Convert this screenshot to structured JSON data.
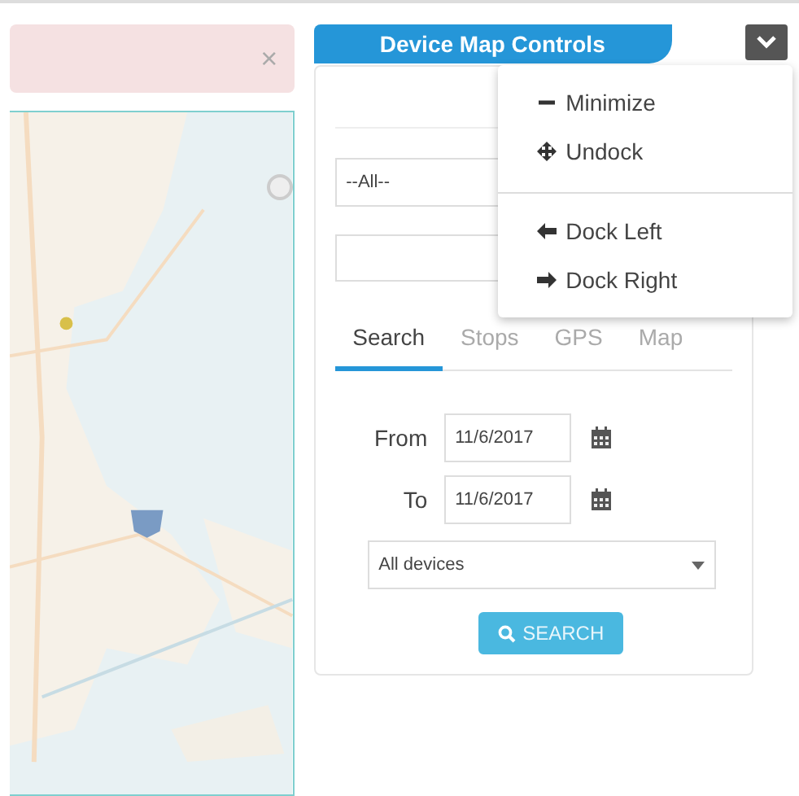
{
  "alert": {
    "close": "×"
  },
  "panel": {
    "title": "Device Map Controls",
    "group_select": {
      "value": "--All--"
    },
    "tabs": [
      {
        "label": "Search",
        "selected": true
      },
      {
        "label": "Stops",
        "selected": false
      },
      {
        "label": "GPS",
        "selected": false
      },
      {
        "label": "Map",
        "selected": false
      }
    ],
    "from": {
      "label": "From",
      "value": "11/6/2017"
    },
    "to": {
      "label": "To",
      "value": "11/6/2017"
    },
    "device_select": {
      "value": "All devices"
    },
    "search_button": "SEARCH"
  },
  "menu": {
    "items": [
      {
        "kind": "minimize",
        "label": "Minimize"
      },
      {
        "kind": "undock",
        "label": "Undock"
      },
      {
        "kind": "divider"
      },
      {
        "kind": "left",
        "label": "Dock Left"
      },
      {
        "kind": "right",
        "label": "Dock Right"
      }
    ]
  }
}
